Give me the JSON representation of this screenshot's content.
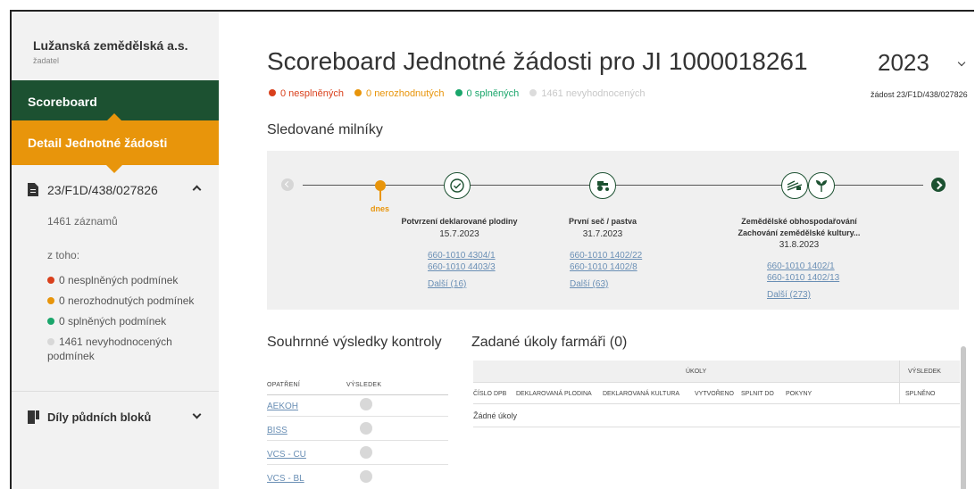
{
  "sidebar": {
    "company": "Lužanská zemědělská a.s.",
    "role": "žadatel",
    "nav_scoreboard": "Scoreboard",
    "nav_detail": "Detail Jednotné žádosti",
    "file_label": "23/F1D/438/027826",
    "records": "1461 záznamů",
    "of_which": "z toho:",
    "stats": [
      {
        "label": "0 nesplněných podmínek",
        "color": "#d9401c"
      },
      {
        "label": "0 nerozhodnutých podmínek",
        "color": "#e8950b"
      },
      {
        "label": "0 splněných podmínek",
        "color": "#1aa66b"
      },
      {
        "label": "1461 nevyhodnocených podmínek",
        "color": "#d8d8d8"
      }
    ],
    "blocks_label": "Díly půdních bloků"
  },
  "header": {
    "title": "Scoreboard Jednotné žádosti pro JI 1000018261",
    "year": "2023",
    "request": "žádost 23/F1D/438/027826",
    "status": [
      {
        "label": "0 nesplněných",
        "color": "#d9401c",
        "text_color": "#d9401c"
      },
      {
        "label": "0 nerozhodnutých",
        "color": "#e8950b",
        "text_color": "#e8950b"
      },
      {
        "label": "0 splněných",
        "color": "#1aa66b",
        "text_color": "#1aa66b"
      },
      {
        "label": "1461 nevyhodnocených",
        "color": "#dcdcdc",
        "text_color": "#c8c8c8"
      }
    ]
  },
  "milestones": {
    "heading": "Sledované milníky",
    "today": "dnes",
    "items": [
      {
        "title": "Potvrzení deklarované plodiny",
        "date": "15.7.2023",
        "links": [
          "660-1010 4304/1",
          "660-1010 4403/3",
          "Další (16)"
        ],
        "icons": [
          "check-circle-icon"
        ]
      },
      {
        "title": "První seč / pastva",
        "date": "31.7.2023",
        "links": [
          "660-1010 1402/22",
          "660-1010 1402/8",
          "Další (63)"
        ],
        "icons": [
          "tractor-icon"
        ]
      },
      {
        "title": "Zemědělské obhospodařování",
        "title2": "Zachování zemědělské kultury...",
        "date": "31.8.2023",
        "links": [
          "660-1010 1402/1",
          "660-1010 1402/13",
          "Další (273)"
        ],
        "icons": [
          "field-icon",
          "plant-icon"
        ]
      }
    ]
  },
  "summary": {
    "heading": "Souhrnné výsledky kontroly",
    "col_measure": "OPATŘENÍ",
    "col_result": "VÝSLEDEK",
    "rows": [
      "AEKOH",
      "BISS",
      "VCS - CU",
      "VCS - BL"
    ]
  },
  "tasks": {
    "heading": "Zadané úkoly farmáři (0)",
    "group_tasks": "ÚKOLY",
    "group_result": "VÝSLEDEK",
    "columns": [
      "ČÍSLO DPB",
      "DEKLAROVANÁ PLODINA",
      "DEKLAROVANÁ KULTURA",
      "VYTVOŘENO",
      "SPLNIT DO",
      "POKYNY"
    ],
    "result_col": "SPLNĚNO",
    "empty": "Žádné úkoly"
  }
}
